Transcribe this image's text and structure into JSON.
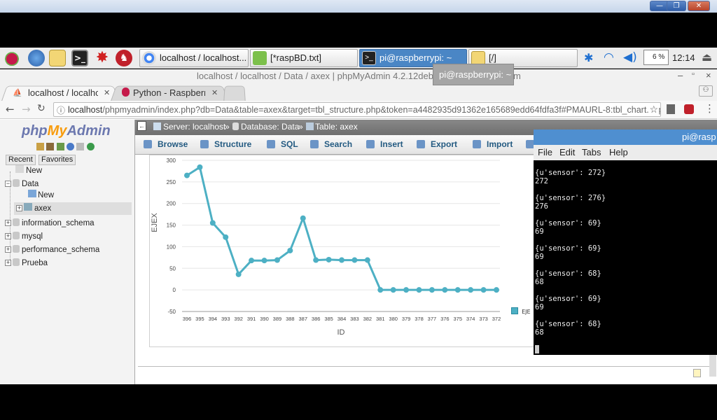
{
  "taskbar": {
    "tasks": [
      {
        "label": "localhost / localhost..."
      },
      {
        "label": "[*raspBD.txt]"
      },
      {
        "label": "pi@raspberrypi: ~"
      },
      {
        "label": "[/]"
      }
    ],
    "cpu": "6 %",
    "clock": "12:14"
  },
  "browser": {
    "window_title": "localhost / localhost / Data / axex | phpMyAdmin 4.2.12deb",
    "window_title_end": "m",
    "tabs": [
      {
        "label": "localhost / localho"
      },
      {
        "label": "Python - Raspberry"
      }
    ],
    "url_host": "localhost",
    "url_rest": "/phpmyadmin/index.php?db=Data&table=axex&target=tbl_structure.php&token=a4482935d91362e165689edd64fdfa3f#PMAURL-8:tbl_chart.php?db=Dat"
  },
  "tooltip": "pi@raspberrypi: ~",
  "pma": {
    "logo_php": "php",
    "logo_my": "My",
    "logo_admin": "Admin",
    "nav_tabs": [
      "Recent",
      "Favorites"
    ],
    "tree": [
      "New",
      "Data",
      "New",
      "axex",
      "information_schema",
      "mysql",
      "performance_schema",
      "Prueba"
    ],
    "breadcrumb": {
      "server": "Server: localhost",
      "database": "Database: Data",
      "table": "Table: axex"
    },
    "tabs": [
      "Browse",
      "Structure",
      "SQL",
      "Search",
      "Insert",
      "Export",
      "Import"
    ]
  },
  "terminal": {
    "title": "pi@rasp",
    "menu": [
      "File",
      "Edit",
      "Tabs",
      "Help"
    ],
    "lines": [
      "{u'sensor': 272}",
      "272",
      "",
      "{u'sensor': 276}",
      "276",
      "",
      "{u'sensor': 69}",
      "69",
      "",
      "{u'sensor': 69}",
      "69",
      "",
      "{u'sensor': 68}",
      "68",
      "",
      "{u'sensor': 69}",
      "69",
      "",
      "{u'sensor': 68}",
      "68"
    ]
  },
  "chart_data": {
    "type": "line",
    "xlabel": "ID",
    "ylabel": "EJEX",
    "categories": [
      "396",
      "395",
      "394",
      "393",
      "392",
      "391",
      "390",
      "389",
      "388",
      "387",
      "386",
      "385",
      "384",
      "383",
      "382",
      "381",
      "380",
      "379",
      "378",
      "377",
      "376",
      "375",
      "374",
      "373",
      "372"
    ],
    "series": [
      {
        "name": "EJE",
        "values": [
          265,
          284,
          155,
          122,
          36,
          68,
          68,
          69,
          91,
          166,
          69,
          70,
          69,
          69,
          69,
          0,
          0,
          0,
          0,
          0,
          0,
          0,
          0,
          0,
          0
        ]
      }
    ],
    "ylim": [
      -50,
      300
    ],
    "yticks": [
      "300",
      "250",
      "200",
      "150",
      "100",
      "50",
      "0",
      "-50"
    ],
    "grid": true,
    "legend": "right",
    "color": "#4db0c4"
  }
}
